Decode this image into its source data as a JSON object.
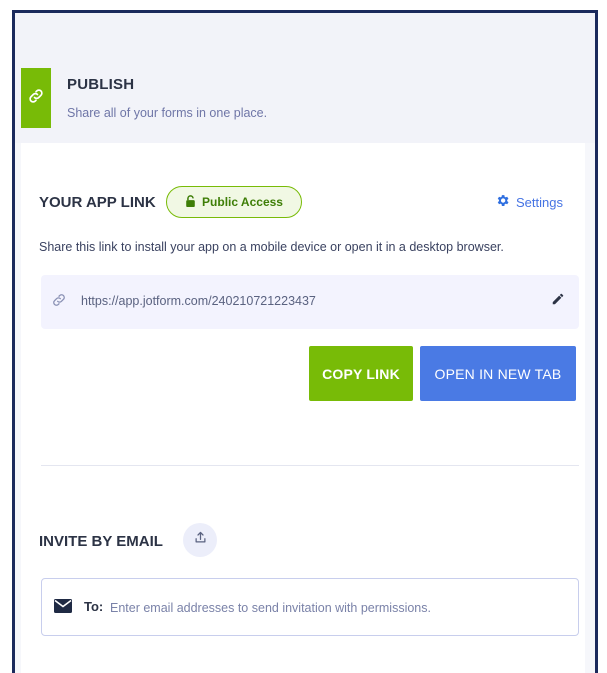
{
  "header": {
    "title": "PUBLISH",
    "subtitle": "Share all of your forms in one place."
  },
  "app_link": {
    "title": "YOUR APP LINK",
    "badge": "Public Access",
    "settings_label": "Settings",
    "description": "Share this link to install your app on a mobile device or open it in a desktop browser.",
    "url": "https://app.jotform.com/240210721223437",
    "copy_label": "COPY LINK",
    "open_label": "OPEN IN NEW TAB"
  },
  "invite": {
    "title": "INVITE BY EMAIL",
    "to_label": "To:",
    "placeholder": "Enter email addresses to send invitation with permissions."
  },
  "colors": {
    "accent_green": "#78bb07",
    "accent_blue": "#4a7ae4",
    "frame_border": "#1b2a5c"
  },
  "icons": {
    "header": "link-icon",
    "badge": "lock-icon",
    "settings": "gear-icon",
    "url": "link-icon",
    "edit": "pencil-icon",
    "invite": "upload-icon",
    "email": "envelope-icon"
  }
}
